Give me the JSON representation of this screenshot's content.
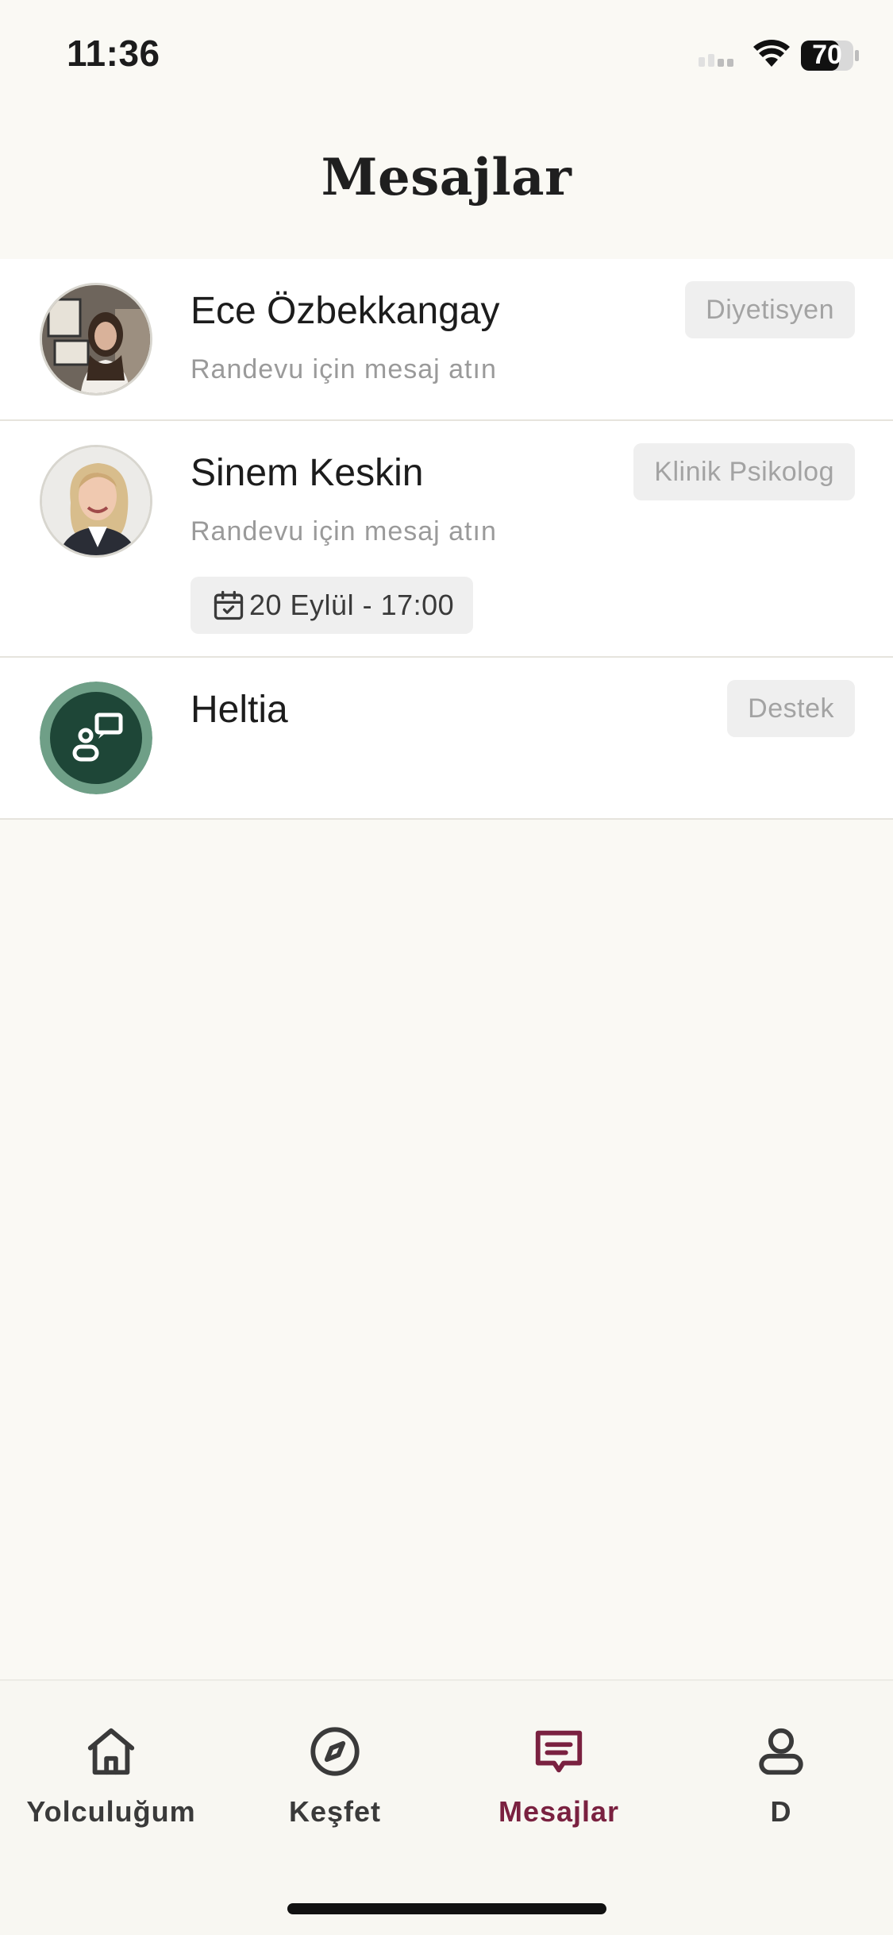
{
  "status_bar": {
    "time": "11:36",
    "battery": "70",
    "icons": [
      "signal-icon",
      "wifi-icon",
      "battery-icon"
    ]
  },
  "header": {
    "title": "Mesajlar"
  },
  "conversations": [
    {
      "name": "Ece Özbekkangay",
      "subtitle": "Randevu için mesaj atın",
      "role": "Diyetisyen"
    },
    {
      "name": "Sinem Keskin",
      "subtitle": "Randevu için mesaj atın",
      "role": "Klinik Psikolog",
      "appointment": "20 Eylül - 17:00"
    },
    {
      "name": "Heltia",
      "role": "Destek"
    }
  ],
  "bottom_nav": {
    "items": [
      {
        "label": "Yolculuğum",
        "icon": "home-icon"
      },
      {
        "label": "Keşfet",
        "icon": "compass-icon"
      },
      {
        "label": "Mesajlar",
        "icon": "message-icon",
        "active": true
      },
      {
        "label": "D",
        "icon": "profile-icon"
      }
    ]
  },
  "colors": {
    "background": "#faf9f4",
    "active_tab": "#7a2140",
    "heltia_avatar": "#1e4637",
    "heltia_ring": "#6f9f87"
  }
}
